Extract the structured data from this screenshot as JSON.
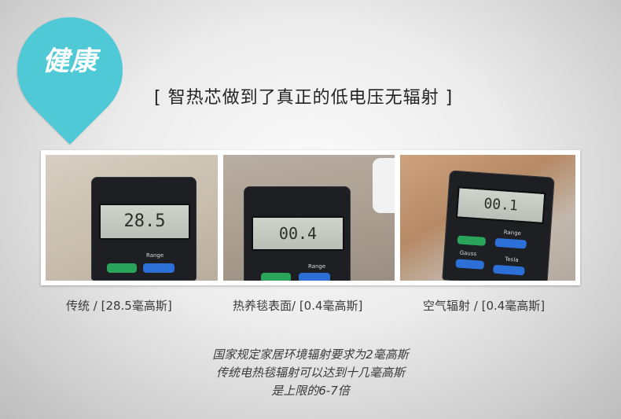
{
  "badge": {
    "label": "健康"
  },
  "headline": "[ 智热芯做到了真正的低电压无辐射 ]",
  "photos": [
    {
      "reading": "28.5",
      "button_label": "Range"
    },
    {
      "reading": "00.4",
      "button_label": "Range"
    },
    {
      "reading": "00.1",
      "button_label": "Range",
      "labels": [
        "Gauss",
        "Tesla"
      ]
    }
  ],
  "captions": [
    "传统 / [28.5毫高斯]",
    "热养毯表面/ [0.4毫高斯]",
    "空气辐射 / [0.4毫高斯]"
  ],
  "notes": [
    "国家规定家居环境辐射要求为2毫高斯",
    "传统电热毯辐射可以达到十几毫高斯",
    "是上限的6-7倍"
  ],
  "colors": {
    "badge": "#4fc9d6",
    "text": "#3a3a3a"
  }
}
